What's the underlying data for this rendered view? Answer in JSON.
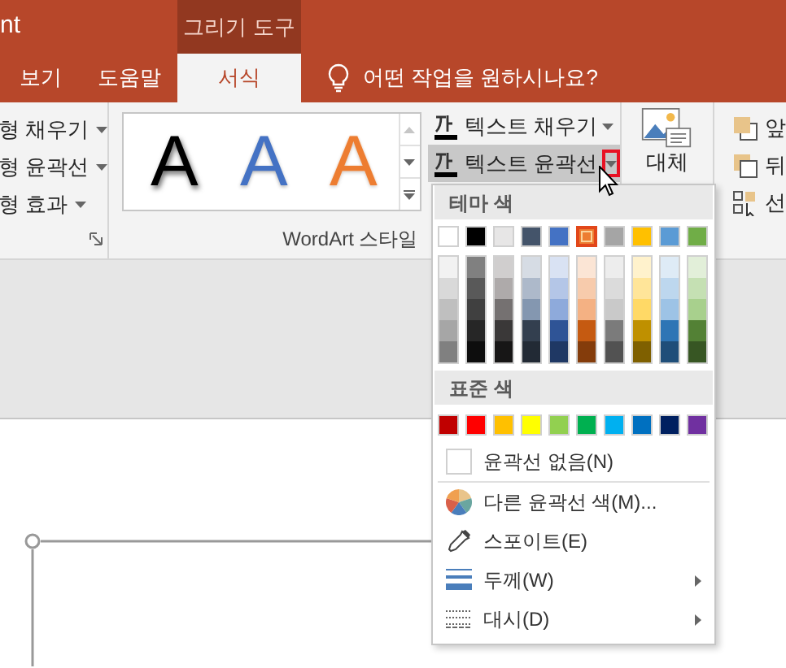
{
  "title_fragment": "nt",
  "contextual_tab": {
    "label": "그리기 도구"
  },
  "tabs": [
    {
      "label": "보기",
      "selected": false
    },
    {
      "label": "도움말",
      "selected": false
    },
    {
      "label": "서식",
      "selected": true
    }
  ],
  "tell_me": {
    "placeholder": "어떤 작업을 원하시나요?"
  },
  "shape_styles": {
    "items": [
      {
        "label": "형 채우기"
      },
      {
        "label": "형 윤곽선"
      },
      {
        "label": "형 효과"
      }
    ]
  },
  "wordart": {
    "gallery": [
      {
        "kind": "shadow",
        "label": "A",
        "color": "#000000"
      },
      {
        "kind": "plain",
        "label": "A",
        "color": "#4472c4"
      },
      {
        "kind": "outline",
        "label": "A",
        "color": "#ed7d31"
      }
    ],
    "commands": [
      {
        "label": "텍스트 채우기",
        "active": false
      },
      {
        "label": "텍스트 윤곽선",
        "active": true
      }
    ],
    "group_label": "WordArt 스타일"
  },
  "alt_text": {
    "label": "대체"
  },
  "arrange": {
    "items": [
      {
        "label": "앞"
      },
      {
        "label": "뒤"
      },
      {
        "label": "선"
      }
    ]
  },
  "outline_menu": {
    "theme_header": "테마 색",
    "theme_colors": [
      {
        "color": "#ffffff",
        "selected": false
      },
      {
        "color": "#000000",
        "selected": false
      },
      {
        "color": "#e7e6e6",
        "selected": false
      },
      {
        "color": "#44546a",
        "selected": false
      },
      {
        "color": "#4472c4",
        "selected": false
      },
      {
        "color": "#ed7d31",
        "selected": true
      },
      {
        "color": "#a5a5a5",
        "selected": false
      },
      {
        "color": "#ffc000",
        "selected": false
      },
      {
        "color": "#5b9bd5",
        "selected": false
      },
      {
        "color": "#70ad47",
        "selected": false
      }
    ],
    "shade_columns": [
      {
        "shades": [
          {
            "color": "#f2f2f2"
          },
          {
            "color": "#d9d9d9"
          },
          {
            "color": "#bfbfbf"
          },
          {
            "color": "#a6a6a6"
          },
          {
            "color": "#808080"
          }
        ]
      },
      {
        "shades": [
          {
            "color": "#808080"
          },
          {
            "color": "#595959"
          },
          {
            "color": "#404040"
          },
          {
            "color": "#262626"
          },
          {
            "color": "#0d0d0d"
          }
        ]
      },
      {
        "shades": [
          {
            "color": "#d0cece"
          },
          {
            "color": "#aeaaaa"
          },
          {
            "color": "#757171"
          },
          {
            "color": "#3a3838"
          },
          {
            "color": "#171616"
          }
        ]
      },
      {
        "shades": [
          {
            "color": "#d6dce4"
          },
          {
            "color": "#adb9ca"
          },
          {
            "color": "#8497b0"
          },
          {
            "color": "#333f4f"
          },
          {
            "color": "#222a35"
          }
        ]
      },
      {
        "shades": [
          {
            "color": "#d9e2f3"
          },
          {
            "color": "#b4c6e7"
          },
          {
            "color": "#8eaadb"
          },
          {
            "color": "#2f5496"
          },
          {
            "color": "#1f3864"
          }
        ]
      },
      {
        "shades": [
          {
            "color": "#fbe5d5"
          },
          {
            "color": "#f7cbac"
          },
          {
            "color": "#f4b183"
          },
          {
            "color": "#c55a11"
          },
          {
            "color": "#843c0b"
          }
        ]
      },
      {
        "shades": [
          {
            "color": "#ededed"
          },
          {
            "color": "#dbdbdb"
          },
          {
            "color": "#c9c9c9"
          },
          {
            "color": "#7b7b7b"
          },
          {
            "color": "#525252"
          }
        ]
      },
      {
        "shades": [
          {
            "color": "#fff2cc"
          },
          {
            "color": "#ffe599"
          },
          {
            "color": "#ffd966"
          },
          {
            "color": "#bf9000"
          },
          {
            "color": "#7f6000"
          }
        ]
      },
      {
        "shades": [
          {
            "color": "#deebf6"
          },
          {
            "color": "#bdd7ee"
          },
          {
            "color": "#9dc3e6"
          },
          {
            "color": "#2e75b5"
          },
          {
            "color": "#1f4e79"
          }
        ]
      },
      {
        "shades": [
          {
            "color": "#e2efd9"
          },
          {
            "color": "#c5e0b3"
          },
          {
            "color": "#a8d08d"
          },
          {
            "color": "#538135"
          },
          {
            "color": "#375623"
          }
        ]
      }
    ],
    "standard_header": "표준 색",
    "standard_colors": [
      {
        "color": "#c00000"
      },
      {
        "color": "#ff0000"
      },
      {
        "color": "#ffc000"
      },
      {
        "color": "#ffff00"
      },
      {
        "color": "#92d050"
      },
      {
        "color": "#00b050"
      },
      {
        "color": "#00b0f0"
      },
      {
        "color": "#0070c0"
      },
      {
        "color": "#002060"
      },
      {
        "color": "#7030a0"
      }
    ],
    "items": [
      {
        "kind": "none",
        "label": "윤곽선 없음(N)"
      },
      {
        "kind": "more",
        "label": "다른 윤곽선 색(M)..."
      },
      {
        "kind": "eyedropper",
        "label": "스포이트(E)"
      },
      {
        "kind": "weight",
        "label": "두께(W)",
        "submenu": true
      },
      {
        "kind": "dash",
        "label": "대시(D)",
        "submenu": true
      }
    ]
  }
}
